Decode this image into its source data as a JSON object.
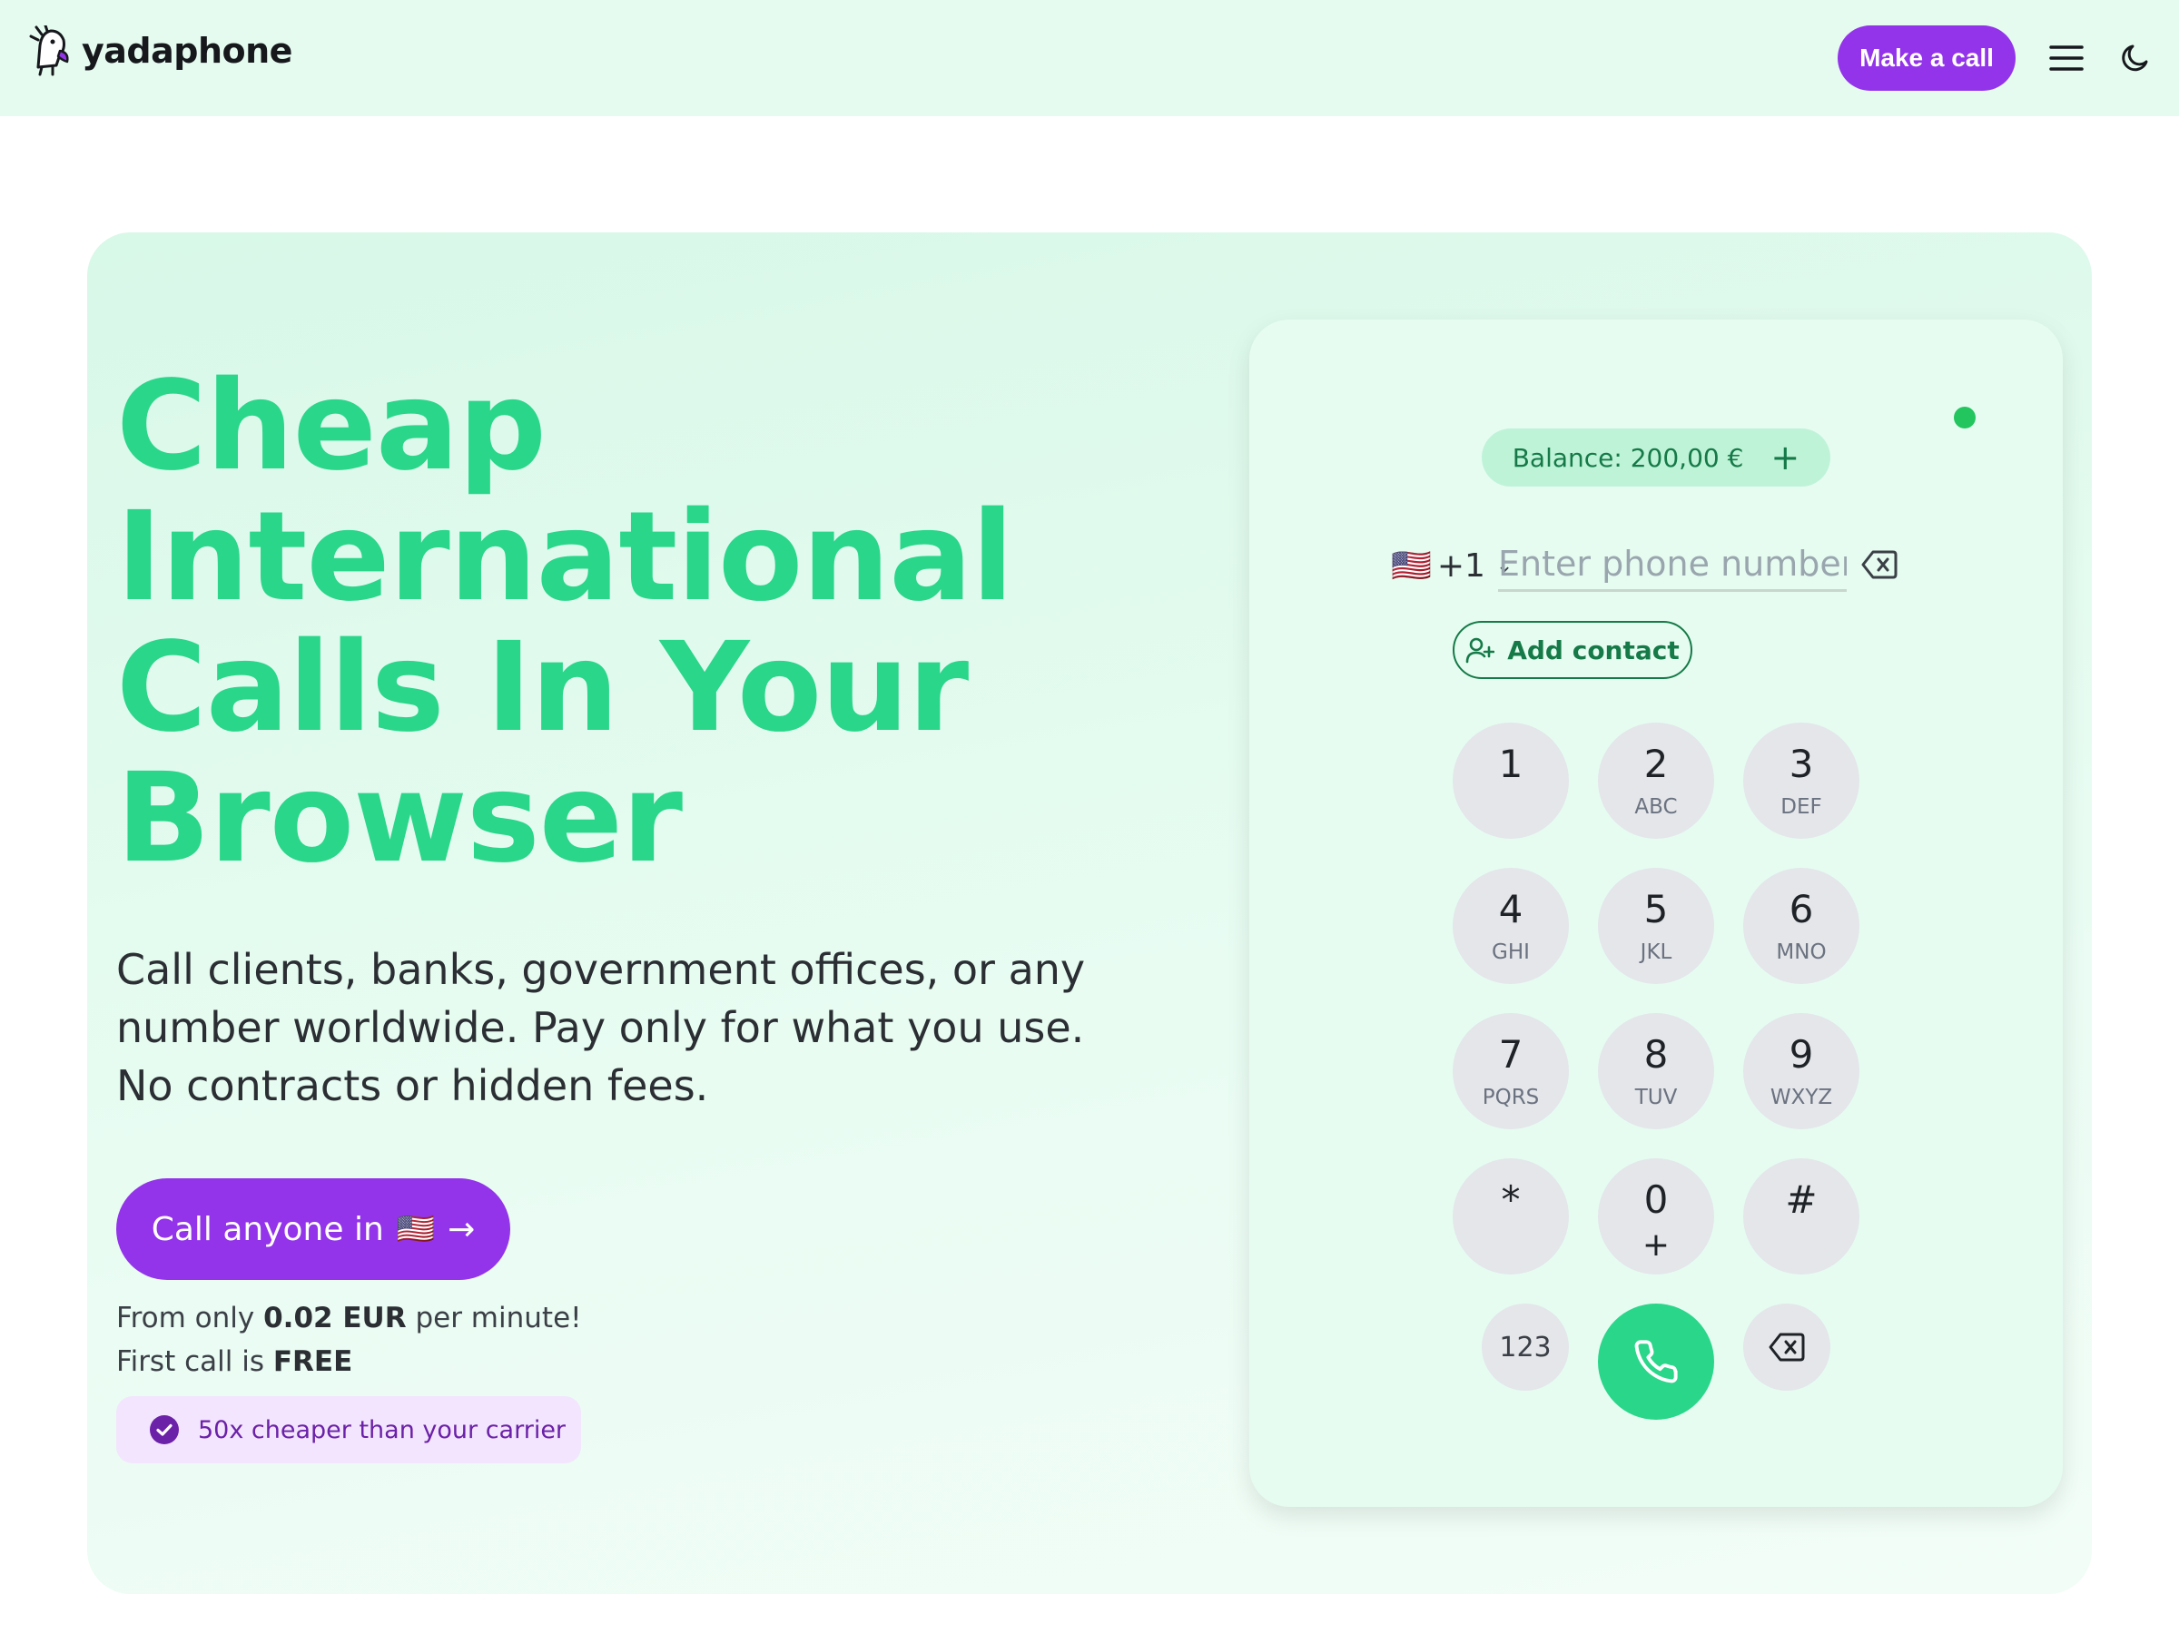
{
  "header": {
    "brand": "yadaphone",
    "make_call_label": "Make a call"
  },
  "hero": {
    "headline_lines": [
      "Cheap",
      "International",
      "Calls In Your",
      "Browser"
    ],
    "subtext_lines": [
      "Call clients, banks, government offices, or any",
      "number worldwide. Pay only for what you use.",
      "No contracts or hidden fees."
    ],
    "cta_label": "Call anyone in",
    "cta_flag": "🇺🇸",
    "cta_arrow": "→",
    "price_prefix": "From only",
    "price_value": "0.02 EUR",
    "price_suffix": "per minute!",
    "free_prefix": "First call is",
    "free_value": "FREE",
    "badge_text": "50x cheaper than your carrier"
  },
  "dialer": {
    "balance_label": "Balance: 200,00 €",
    "balance_plus": "+",
    "country_flag": "🇺🇸",
    "country_code": "+1",
    "country_chevron": "⌄",
    "phone_value": "",
    "phone_placeholder": "Enter phone number",
    "add_contact_label": "Add contact",
    "keys": [
      {
        "digit": "1",
        "letters": ""
      },
      {
        "digit": "2",
        "letters": "ABC"
      },
      {
        "digit": "3",
        "letters": "DEF"
      },
      {
        "digit": "4",
        "letters": "GHI"
      },
      {
        "digit": "5",
        "letters": "JKL"
      },
      {
        "digit": "6",
        "letters": "MNO"
      },
      {
        "digit": "7",
        "letters": "PQRS"
      },
      {
        "digit": "8",
        "letters": "TUV"
      },
      {
        "digit": "9",
        "letters": "WXYZ"
      },
      {
        "digit": "*",
        "letters": ""
      },
      {
        "digit": "0",
        "letters": "+"
      },
      {
        "digit": "#",
        "letters": ""
      }
    ],
    "mode_key_label": "123"
  },
  "colors": {
    "accent_purple": "#9333ea",
    "accent_green": "#2ad68a",
    "balance_green": "#157a47",
    "status_online": "#22c55e"
  },
  "icons": {
    "menu": "hamburger-menu-icon",
    "theme": "moon-icon",
    "add_contact": "user-plus-icon",
    "backspace": "backspace-icon",
    "call": "phone-icon",
    "badge": "check-circle-icon"
  }
}
